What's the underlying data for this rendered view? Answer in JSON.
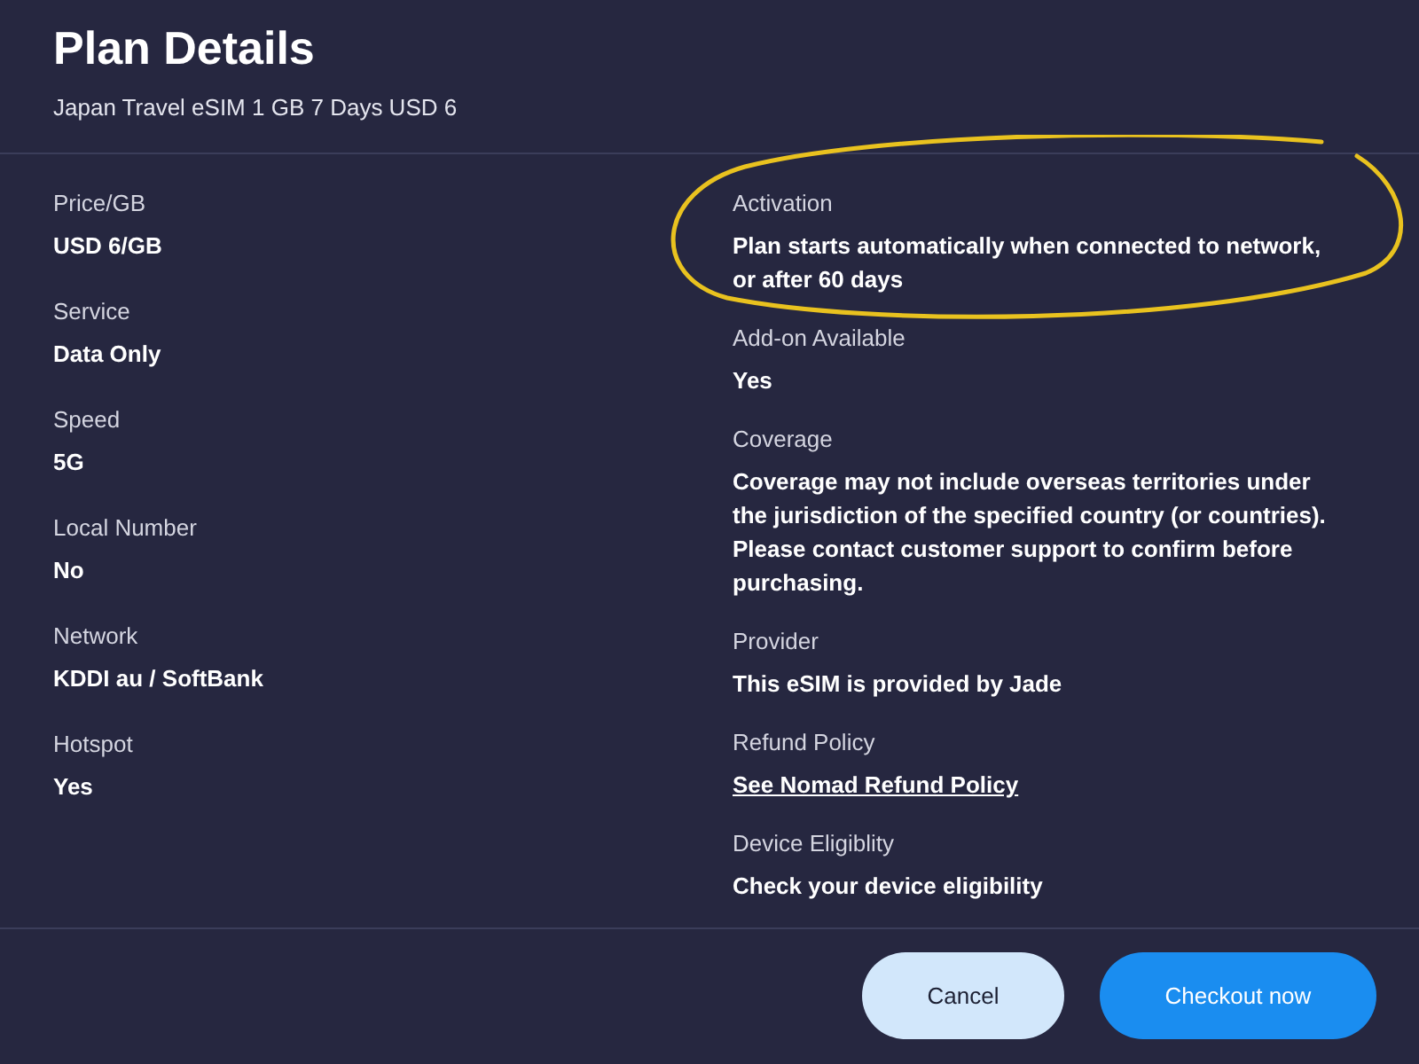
{
  "title": "Plan Details",
  "subtitle": "Japan Travel eSIM 1 GB 7 Days USD 6",
  "left_details": [
    {
      "label": "Price/GB",
      "value": "USD 6/GB",
      "kind": "text"
    },
    {
      "label": "Service",
      "value": "Data Only",
      "kind": "text"
    },
    {
      "label": "Speed",
      "value": "5G",
      "kind": "text"
    },
    {
      "label": "Local Number",
      "value": "No",
      "kind": "text"
    },
    {
      "label": "Network",
      "value": "KDDI au / SoftBank",
      "kind": "text"
    },
    {
      "label": "Hotspot",
      "value": "Yes",
      "kind": "text"
    }
  ],
  "right_details": [
    {
      "label": "Activation",
      "value": "Plan starts automatically when connected to network, or after 60 days",
      "kind": "text"
    },
    {
      "label": "Add-on Available",
      "value": "Yes",
      "kind": "text"
    },
    {
      "label": "Coverage",
      "value": "Coverage may not include overseas territories under the jurisdiction of the specified country (or countries). Please contact customer support to confirm before purchasing.",
      "kind": "text"
    },
    {
      "label": "Provider",
      "value": "This eSIM is provided by Jade",
      "kind": "text"
    },
    {
      "label": "Refund Policy",
      "value": "See Nomad Refund Policy",
      "kind": "link"
    },
    {
      "label": "Device Eligiblity",
      "value": "Check your device eligibility",
      "kind": "text"
    }
  ],
  "buttons": [
    {
      "label": "Cancel",
      "kind": "secondary"
    },
    {
      "label": "Checkout now",
      "kind": "primary"
    }
  ]
}
